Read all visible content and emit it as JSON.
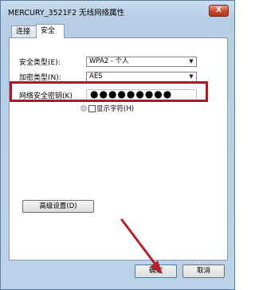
{
  "window": {
    "title": "MERCURY_3521F2 无线网络属性",
    "close_label": "X"
  },
  "tabs": [
    {
      "label": "连接",
      "active": false
    },
    {
      "label": "安全",
      "active": true
    }
  ],
  "security_type": {
    "label": "安全类型(E):",
    "value": "WPA2 - 个人"
  },
  "encryption_type": {
    "label": "加密类型(N):",
    "value": "AES"
  },
  "network_key": {
    "label": "网络安全密钥(K)",
    "masked_value": "●●●●●●●●●"
  },
  "show_characters": {
    "label": "显示字符(H)",
    "checked": false
  },
  "advanced_button": {
    "label": "高级设置(D)"
  },
  "ok_button": {
    "label": "确定"
  },
  "cancel_button": {
    "label": "取消"
  },
  "colors": {
    "highlight_box": "#9b2027",
    "arrow": "#b2202a"
  },
  "icons": {
    "dropdown": "chevron-down-icon",
    "shield": "shield-icon",
    "close": "close-icon"
  }
}
